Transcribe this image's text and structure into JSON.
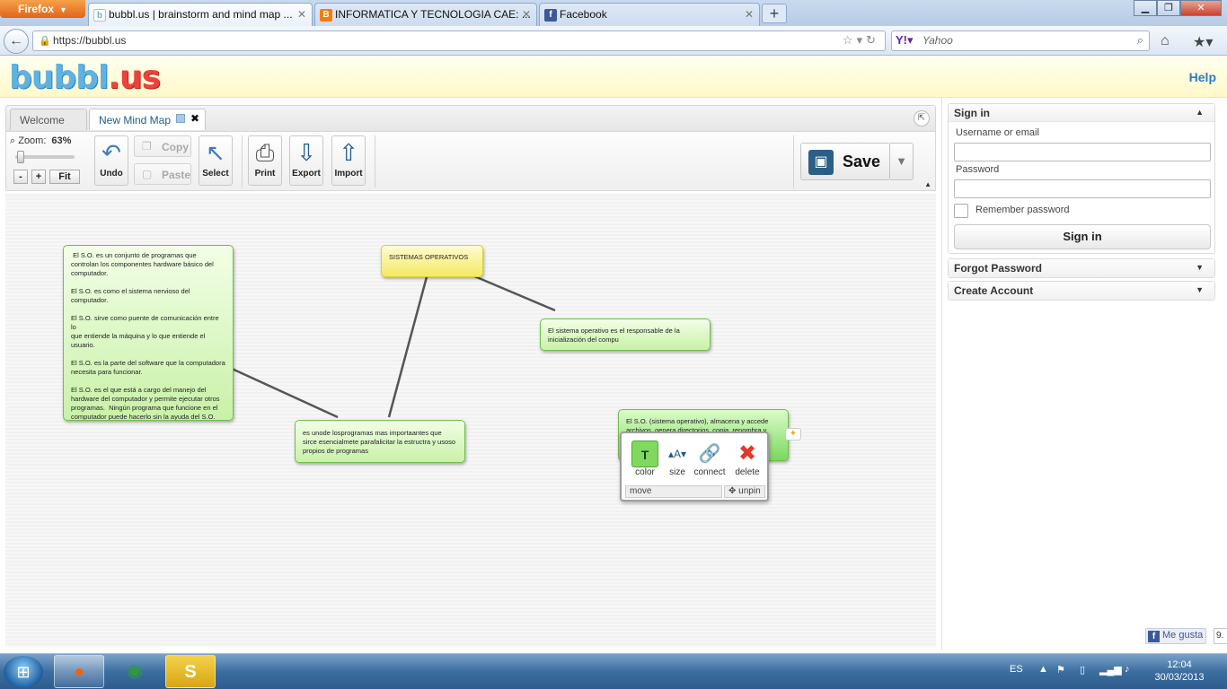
{
  "browser": {
    "menu_label": "Firefox",
    "tabs": [
      {
        "title": "bubbl.us | brainstorm and mind map ...",
        "active": true,
        "favicon": "bubbl-icon"
      },
      {
        "title": "INFORMATICA Y TECNOLOGIA CAE: ...",
        "active": false,
        "favicon": "blogger-icon"
      },
      {
        "title": "Facebook",
        "active": false,
        "favicon": "facebook-icon"
      }
    ],
    "url": "https://bubbl.us",
    "search_placeholder": "Yahoo"
  },
  "site": {
    "logo_main": "bubbl",
    "logo_dot": ".",
    "logo_tld": "us",
    "help_link": "Help"
  },
  "app": {
    "tabs": [
      {
        "label": "Welcome",
        "active": false
      },
      {
        "label": "New Mind Map",
        "active": true
      }
    ],
    "toolbar": {
      "zoom_label": "Zoom:",
      "zoom_value": "63%",
      "zoom_minus": "-",
      "zoom_plus": "+",
      "zoom_fit": "Fit",
      "undo": "Undo",
      "copy": "Copy",
      "paste": "Paste",
      "select": "Select",
      "print": "Print",
      "export": "Export",
      "import": "Import",
      "save": "Save"
    },
    "bubbles": [
      {
        "id": "left",
        "text": " El S.O. es un conjunto de programas que\ncontrolan los componentes hardware básico del\ncomputador.\n\nEl S.O. es como el sistema nervioso del\ncomputador.\n\nEl S.O. sirve como puente de comunicación entre lo\nque entiende la máquina y lo que entiende el\nusuario.\n\nEl S.O. es la parte del software que la computadora\nnecesita para funcionar.\n\nEl S.O. es el que está a cargo del manejo del\nhardware del computador y permite ejecutar otros\nprogramas.  Ningún programa que funcione en el\ncomputador puede hacerlo sin la ayuda del S.O."
      },
      {
        "id": "center",
        "text": "SISTEMAS OPERATIVOS"
      },
      {
        "id": "bottom",
        "text": "es unode losprogramas mas importaantes que\nsirce esencialmete parafalicitar la estructra y usoso\npropios de programas"
      },
      {
        "id": "right-top",
        "text": "El sistema operativo es el responsable de la\ninicialización del compu"
      },
      {
        "id": "right-bottom",
        "text": "El S.O. (sistema operativo), almacena y accede\narchivos, genera directorios, copia, renombra y\ntransfiere archivos entre discos, memoria y\ndispositivos de entrada y salida."
      }
    ],
    "context_menu": {
      "color": "color",
      "size": "size",
      "connect": "connect",
      "delete": "delete",
      "move": "move",
      "unpin": "unpin"
    }
  },
  "sidebar": {
    "signin_title": "Sign in",
    "username_label": "Username or email",
    "password_label": "Password",
    "remember_label": "Remember password",
    "signin_button": "Sign in",
    "forgot_title": "Forgot Password",
    "create_title": "Create Account",
    "like_label": "Me gusta",
    "like_count": "9."
  },
  "taskbar": {
    "language": "ES",
    "time": "12:04",
    "date": "30/03/2013"
  }
}
